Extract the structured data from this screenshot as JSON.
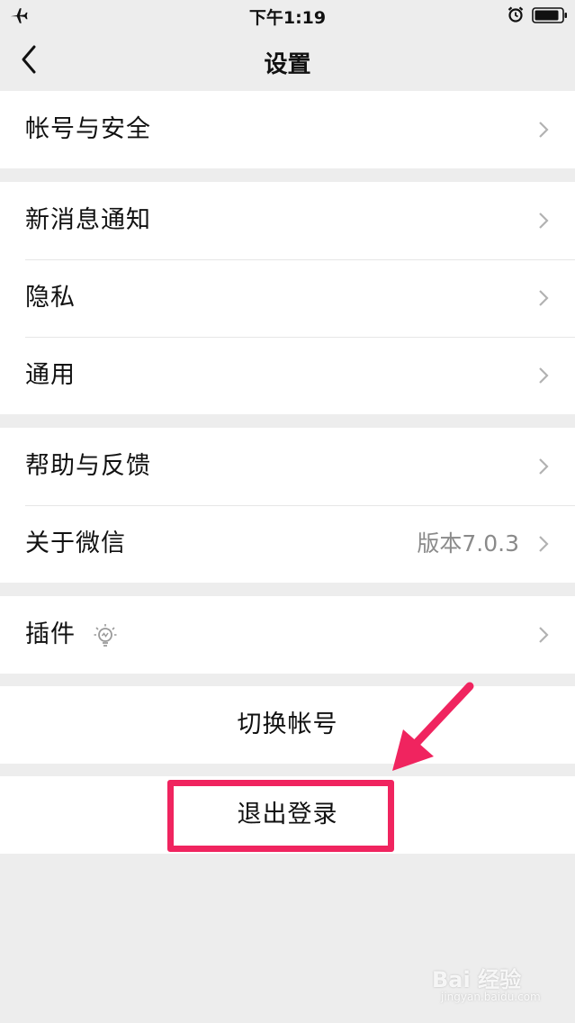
{
  "status_bar": {
    "time": "下午1:19",
    "airplane_icon": "airplane-icon",
    "alarm_icon": "alarm-icon",
    "battery_icon": "battery-icon"
  },
  "nav": {
    "title": "设置",
    "back_icon": "chevron-left-icon"
  },
  "groups": [
    {
      "items": [
        {
          "label": "帐号与安全"
        }
      ]
    },
    {
      "items": [
        {
          "label": "新消息通知"
        },
        {
          "label": "隐私"
        },
        {
          "label": "通用"
        }
      ]
    },
    {
      "items": [
        {
          "label": "帮助与反馈"
        },
        {
          "label": "关于微信",
          "value": "版本7.0.3"
        }
      ]
    },
    {
      "items": [
        {
          "label": "插件",
          "icon": "lightbulb-icon"
        }
      ]
    }
  ],
  "switch_account": {
    "label": "切换帐号"
  },
  "logout": {
    "label": "退出登录"
  },
  "annotation": {
    "color": "#f0245f"
  },
  "watermark": {
    "text": "Bai 经验",
    "sub": "jingyan.baidu.com"
  },
  "colors": {
    "background": "#ededed",
    "cell": "#ffffff",
    "secondary_text": "#8a8a8a",
    "accent": "#f0245f"
  }
}
